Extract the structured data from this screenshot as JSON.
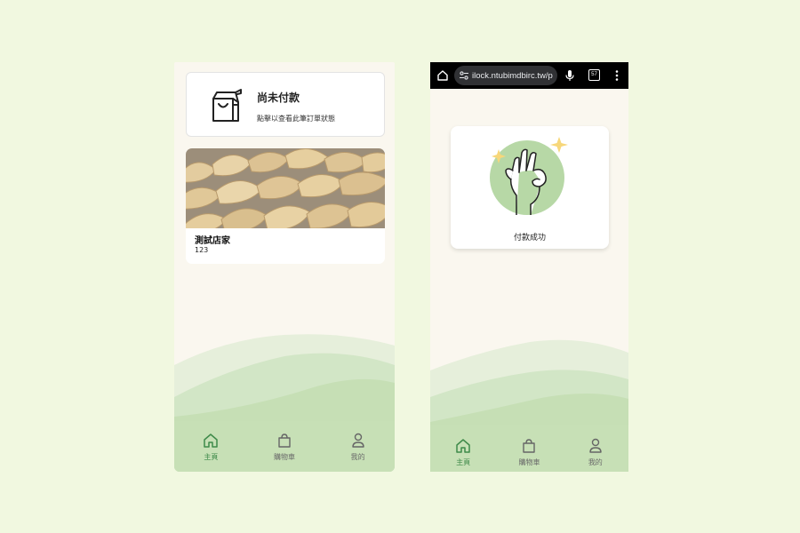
{
  "left_screen": {
    "order_card": {
      "title": "尚未付款",
      "subtitle": "點擊以查看此筆訂單狀態",
      "icon": "shopping-bag-icon"
    },
    "store_card": {
      "name": "測試店家",
      "description": "123",
      "image": "dumplings-photo"
    },
    "bottom_nav": [
      {
        "label": "主頁",
        "icon": "home-icon",
        "active": true
      },
      {
        "label": "購物車",
        "icon": "shopping-bag-icon",
        "active": false
      },
      {
        "label": "我的",
        "icon": "person-icon",
        "active": false
      }
    ]
  },
  "right_screen": {
    "browser": {
      "url": "ilock.ntubimdbirc.tw/p",
      "tab_count": "57",
      "icons": [
        "home-icon",
        "site-settings-icon",
        "microphone-icon",
        "tabs-icon",
        "more-menu-icon"
      ]
    },
    "success_card": {
      "message": "付款成功",
      "illustration": "ok-hand-icon"
    },
    "bottom_nav": [
      {
        "label": "主頁",
        "icon": "home-icon",
        "active": true
      },
      {
        "label": "購物車",
        "icon": "shopping-bag-icon",
        "active": false
      },
      {
        "label": "我的",
        "icon": "person-icon",
        "active": false
      }
    ]
  },
  "colors": {
    "page_background": "#f1f8e0",
    "screen_background": "#faf7ef",
    "accent_green": "#3f8a4a",
    "wave_light": "#e6efdb",
    "wave_mid": "#d2e6c6",
    "wave_dark": "#c6dfb5",
    "nav_background": "#c7e0b6"
  }
}
